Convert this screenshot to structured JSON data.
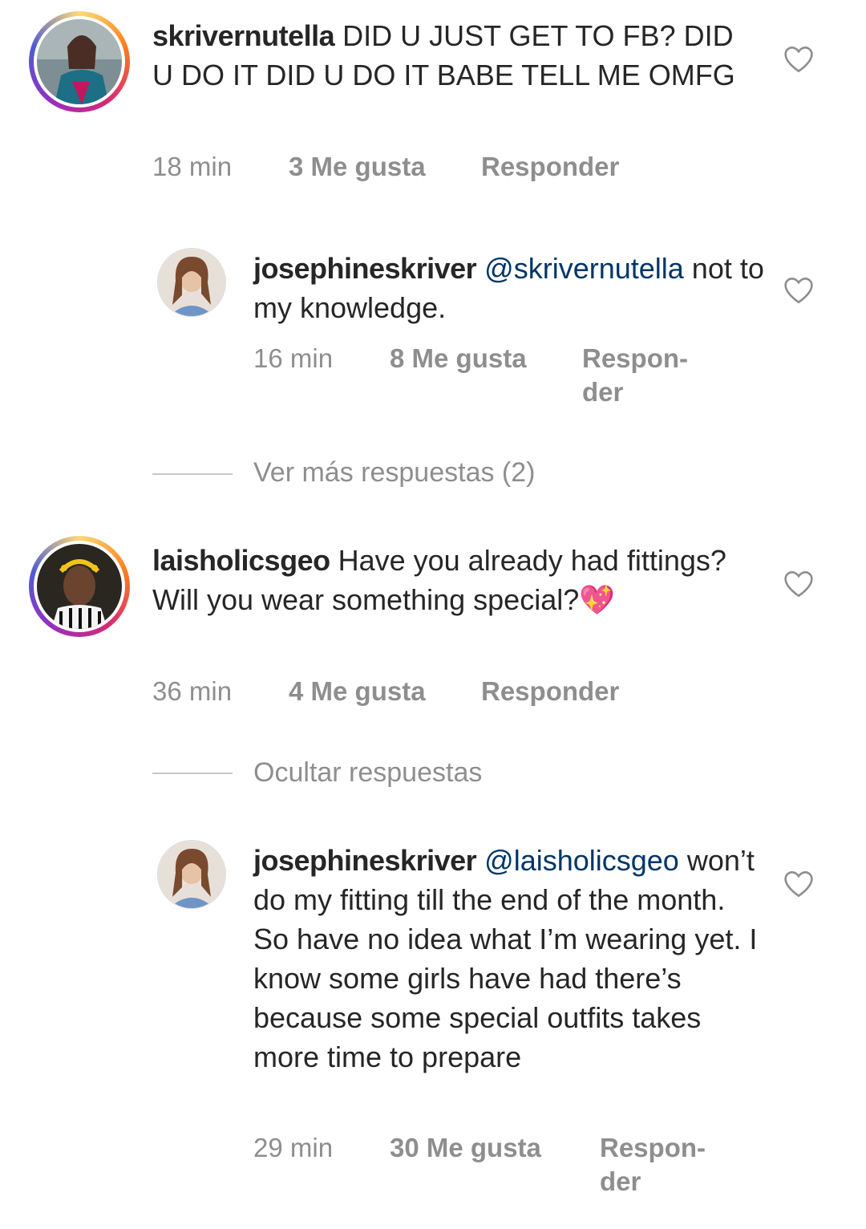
{
  "comments": [
    {
      "username": "skrivernutella",
      "text": "DID U JUST GET TO FB? DID U DO IT DID U DO IT BABE TELL ME OMFG",
      "time": "18 min",
      "likes": "3 Me gusta",
      "reply": "Responder"
    },
    {
      "username": "josephineskriver",
      "mention": "@skrivernutella",
      "text": "not to my knowledge.",
      "time": "16 min",
      "likes": "8 Me gusta",
      "reply_line1": "Respon-",
      "reply_line2": "der"
    },
    {
      "username": "laisholicsgeo",
      "text": "Have you already had fittings? Will you wear something special?",
      "emoji": "💖",
      "time": "36 min",
      "likes": "4 Me gusta",
      "reply": "Responder"
    },
    {
      "username": "josephineskriver",
      "mention": "@laisholicsgeo",
      "text": "won’t do my fitting till the end of the month. So have no idea what I’m wearing yet. I know some girls have had there’s because some special outfits takes more time to prepare",
      "time": "29 min",
      "likes": "30 Me gusta",
      "reply_line1": "Respon-",
      "reply_line2": "der"
    }
  ],
  "view_more_replies": "Ver más respuestas (2)",
  "hide_replies": "Ocultar respuestas",
  "icons": {
    "like": "heart-outline-icon"
  },
  "colors": {
    "text": "#262626",
    "meta": "#8e8e8e",
    "mention": "#003569"
  }
}
